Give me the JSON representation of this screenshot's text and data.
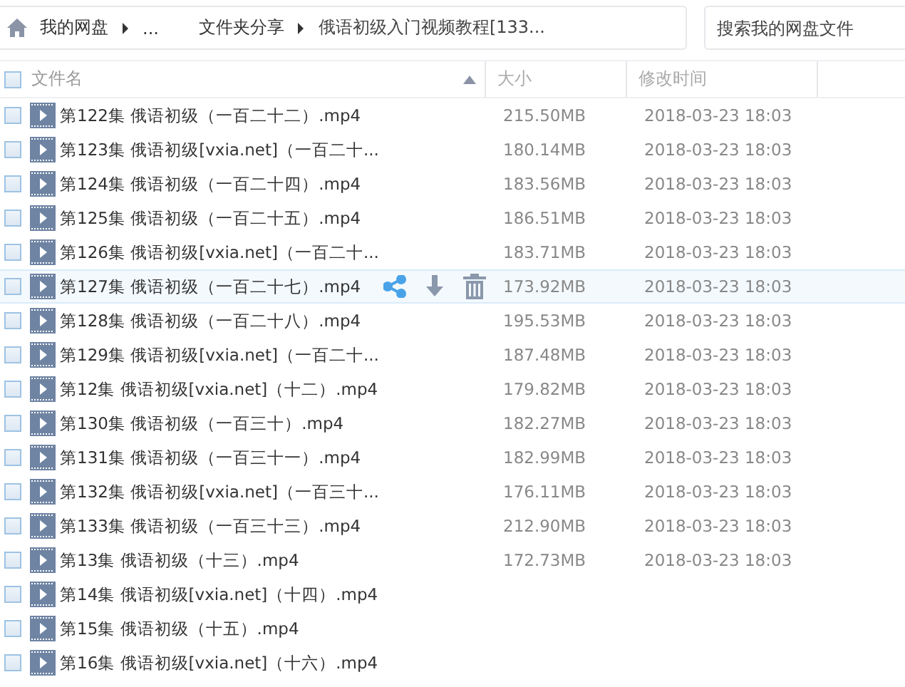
{
  "breadcrumb": {
    "items": [
      {
        "kind": "home",
        "label": "我的网盘"
      },
      {
        "kind": "ellipsis",
        "label": "..."
      },
      {
        "kind": "folder",
        "label": "文件夹分享"
      },
      {
        "kind": "current",
        "label": "俄语初级入门视频教程[133..."
      }
    ]
  },
  "search": {
    "placeholder": "搜索我的网盘文件"
  },
  "table": {
    "select_all": {
      "checked": false
    },
    "columns": [
      {
        "label": "文件名",
        "sorted": true
      },
      {
        "label": "大小",
        "sorted": false
      },
      {
        "label": "修改时间",
        "sorted": false
      }
    ],
    "rows": [
      {
        "name": "第122集 俄语初级（一百二十二）.mp4",
        "size": "215.50MB",
        "modified": "2018-03-23 18:03",
        "checked": false,
        "hovered": false
      },
      {
        "name": "第123集 俄语初级[vxia.net]（一百二十...",
        "size": "180.14MB",
        "modified": "2018-03-23 18:03",
        "checked": false,
        "hovered": false
      },
      {
        "name": "第124集 俄语初级（一百二十四）.mp4",
        "size": "183.56MB",
        "modified": "2018-03-23 18:03",
        "checked": false,
        "hovered": false
      },
      {
        "name": "第125集 俄语初级（一百二十五）.mp4",
        "size": "186.51MB",
        "modified": "2018-03-23 18:03",
        "checked": false,
        "hovered": false
      },
      {
        "name": "第126集 俄语初级[vxia.net]（一百二十...",
        "size": "183.71MB",
        "modified": "2018-03-23 18:03",
        "checked": false,
        "hovered": false
      },
      {
        "name": "第127集 俄语初级（一百二十七）.mp4",
        "size": "173.92MB",
        "modified": "2018-03-23 18:03",
        "checked": false,
        "hovered": true
      },
      {
        "name": "第128集 俄语初级（一百二十八）.mp4",
        "size": "195.53MB",
        "modified": "2018-03-23 18:03",
        "checked": false,
        "hovered": false
      },
      {
        "name": "第129集 俄语初级[vxia.net]（一百二十...",
        "size": "187.48MB",
        "modified": "2018-03-23 18:03",
        "checked": false,
        "hovered": false
      },
      {
        "name": "第12集 俄语初级[vxia.net]（十二）.mp4",
        "size": "179.82MB",
        "modified": "2018-03-23 18:03",
        "checked": false,
        "hovered": false
      },
      {
        "name": "第130集 俄语初级（一百三十）.mp4",
        "size": "182.27MB",
        "modified": "2018-03-23 18:03",
        "checked": false,
        "hovered": false
      },
      {
        "name": "第131集 俄语初级（一百三十一）.mp4",
        "size": "182.99MB",
        "modified": "2018-03-23 18:03",
        "checked": false,
        "hovered": false
      },
      {
        "name": "第132集 俄语初级[vxia.net]（一百三十...",
        "size": "176.11MB",
        "modified": "2018-03-23 18:03",
        "checked": false,
        "hovered": false
      },
      {
        "name": "第133集 俄语初级（一百三十三）.mp4",
        "size": "212.90MB",
        "modified": "2018-03-23 18:03",
        "checked": false,
        "hovered": false
      },
      {
        "name": "第13集 俄语初级（十三）.mp4",
        "size": "172.73MB",
        "modified": "2018-03-23 18:03",
        "checked": false,
        "hovered": false
      },
      {
        "name": "第14集 俄语初级[vxia.net]（十四）.mp4",
        "checked": false,
        "hovered": false
      },
      {
        "name": "第15集 俄语初级（十五）.mp4",
        "checked": false,
        "hovered": false
      },
      {
        "name": "第16集 俄语初级[vxia.net]（十六）.mp4",
        "checked": false,
        "hovered": false
      }
    ]
  }
}
